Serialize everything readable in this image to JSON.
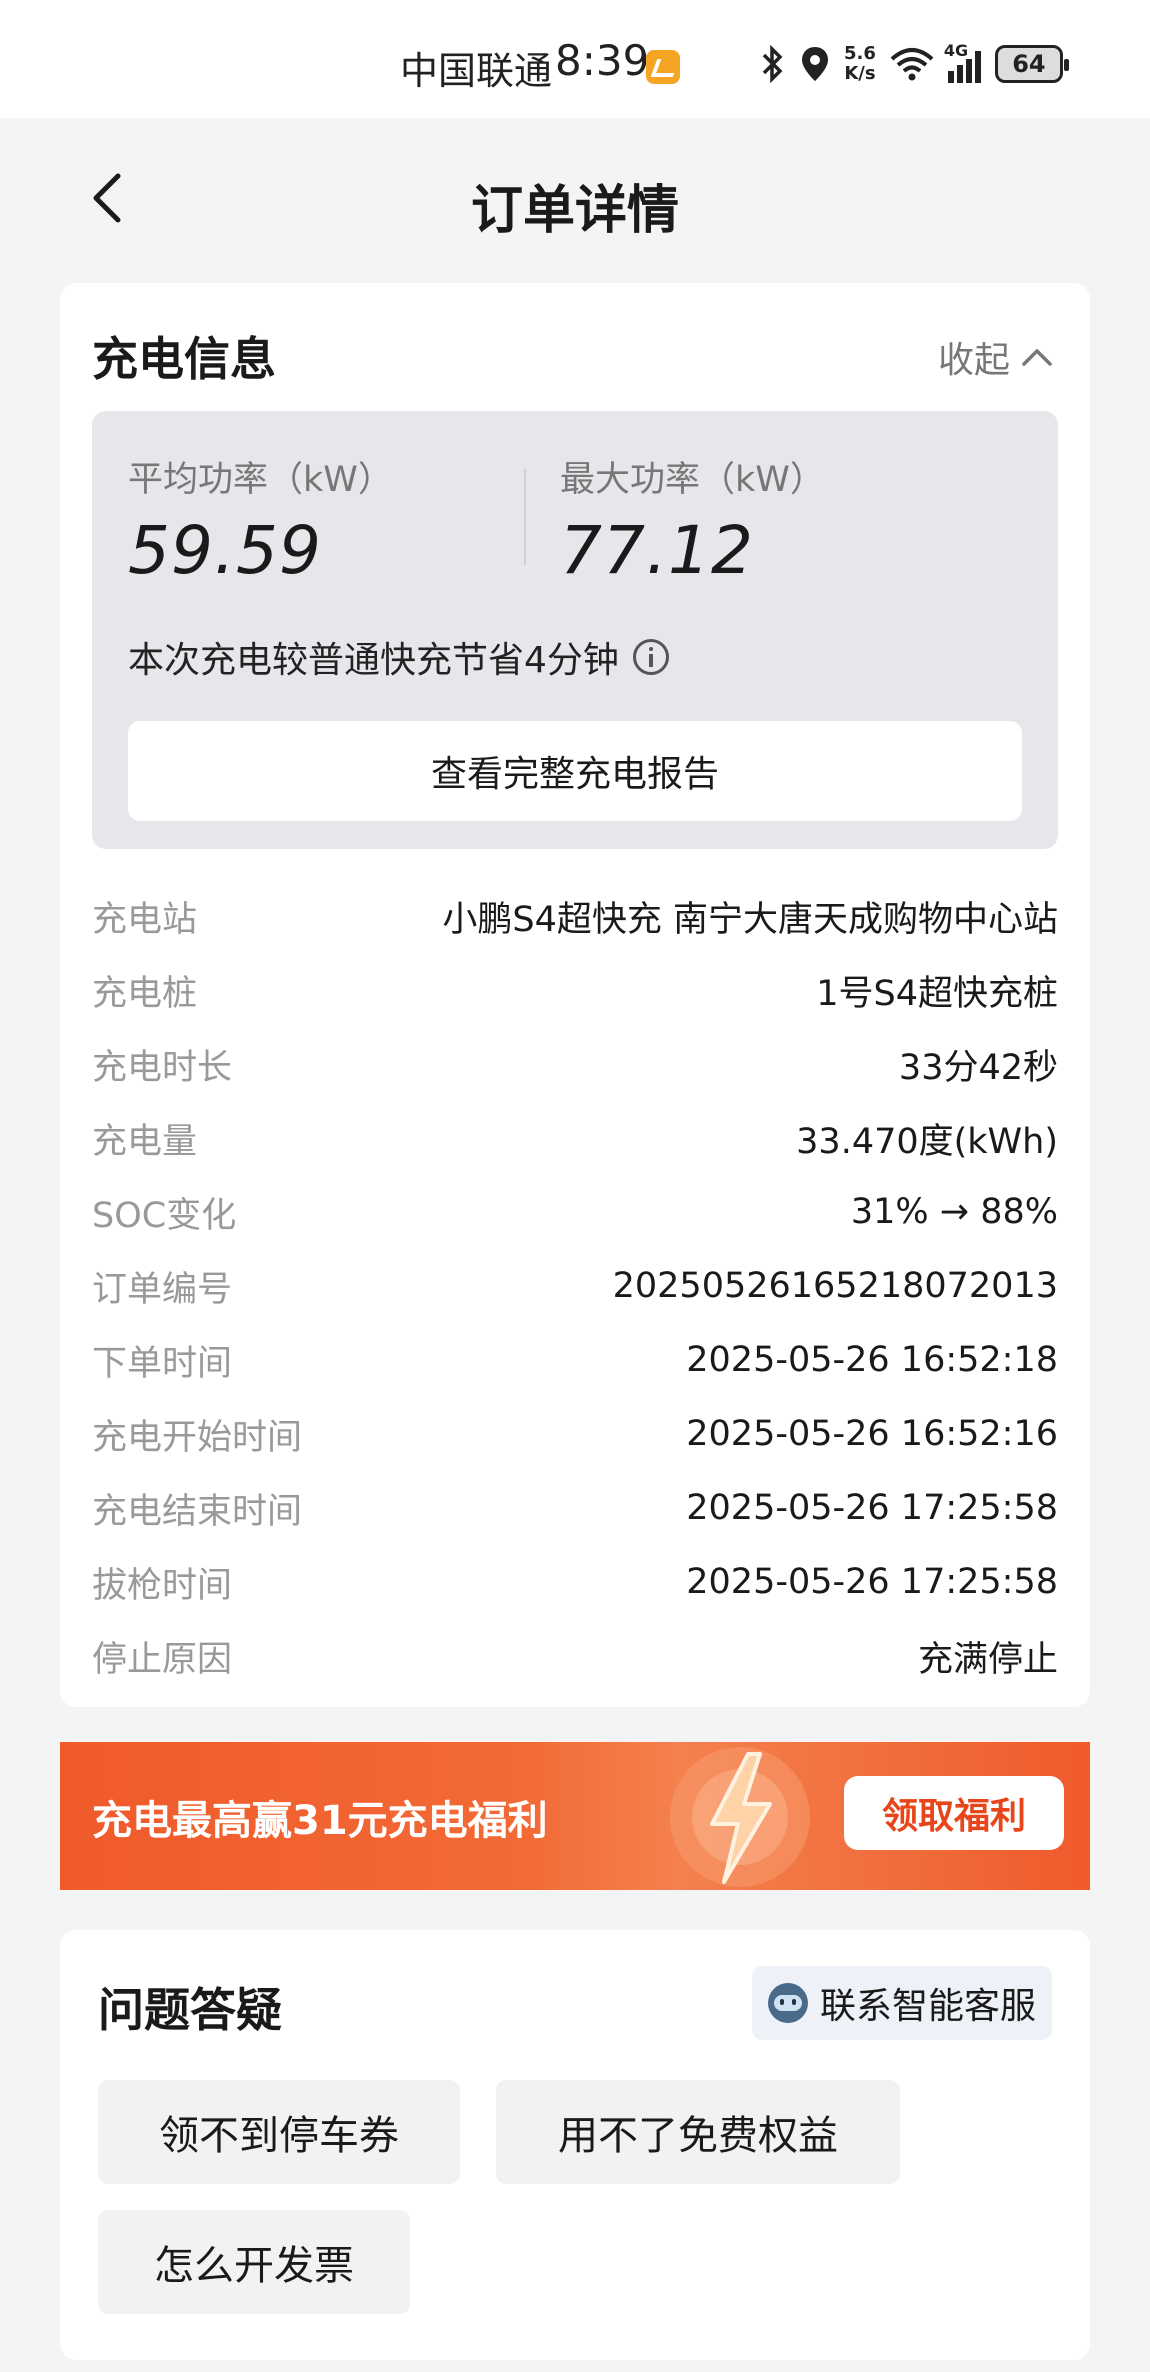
{
  "status_bar": {
    "carrier": "中国联通",
    "time": "8:39",
    "speed_value": "5.6",
    "speed_unit": "K/s",
    "network": "4G",
    "battery": "64"
  },
  "nav": {
    "title": "订单详情"
  },
  "charging_info": {
    "title": "充电信息",
    "collapse_label": "收起",
    "avg_power_label": "平均功率（kW）",
    "avg_power_value": "59.59",
    "max_power_label": "最大功率（kW）",
    "max_power_value": "77.12",
    "saving_text": "本次充电较普通快充节省4分钟",
    "report_button": "查看完整充电报告",
    "rows": [
      {
        "label": "充电站",
        "value": "小鹏S4超快充 南宁大唐天成购物中心站"
      },
      {
        "label": "充电桩",
        "value": "1号S4超快充桩"
      },
      {
        "label": "充电时长",
        "value": "33分42秒"
      },
      {
        "label": "充电量",
        "value": "33.470度(kWh)"
      },
      {
        "label": "SOC变化",
        "value": "31% → 88%"
      },
      {
        "label": "订单编号",
        "value": "2025052616521807201​3"
      },
      {
        "label": "下单时间",
        "value": "2025-05-26 16:52:18"
      },
      {
        "label": "充电开始时间",
        "value": "2025-05-26 16:52:16"
      },
      {
        "label": "充电结束时间",
        "value": "2025-05-26 17:25:58"
      },
      {
        "label": "拔枪时间",
        "value": "2025-05-26 17:25:58"
      },
      {
        "label": "停止原因",
        "value": "充满停止"
      }
    ]
  },
  "banner": {
    "text": "充电最高赢31元充电福利",
    "button": "领取福利"
  },
  "qa": {
    "title": "问题答疑",
    "customer_service": "联系智能客服",
    "chips": [
      "领不到停车券",
      "用不了免费权益",
      "怎么开发票"
    ]
  },
  "colors": {
    "accent_orange": "#f05a2a",
    "background": "#f4f4f5"
  }
}
